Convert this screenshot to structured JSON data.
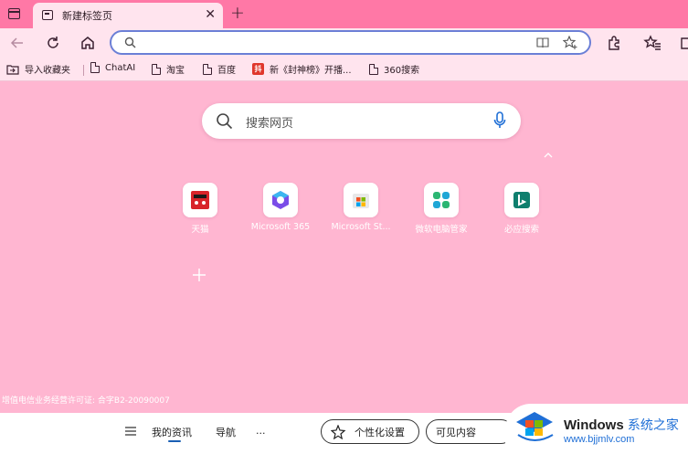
{
  "tab": {
    "title": "新建标签页"
  },
  "address_bar": {
    "value": "",
    "placeholder": ""
  },
  "bookmarks": [
    {
      "label": "导入收藏夹",
      "icon": "import-folder-icon"
    },
    {
      "label": "ChatAI",
      "icon": "page-icon"
    },
    {
      "label": "淘宝",
      "icon": "page-icon"
    },
    {
      "label": "百度",
      "icon": "page-icon"
    },
    {
      "label": "新《封神榜》开播...",
      "icon": "site-icon"
    },
    {
      "label": "360搜索",
      "icon": "page-icon"
    }
  ],
  "search": {
    "placeholder": "搜索网页"
  },
  "quick_links": [
    {
      "label": "天猫",
      "icon": "tmall-icon"
    },
    {
      "label": "Microsoft 365",
      "icon": "microsoft-365-icon"
    },
    {
      "label": "Microsoft St...",
      "icon": "microsoft-store-icon"
    },
    {
      "label": "微软电脑管家",
      "icon": "pc-manager-icon"
    },
    {
      "label": "必应搜索",
      "icon": "bing-icon"
    }
  ],
  "license": "增值电信业务经营许可证: 合字B2-20090007",
  "footer": {
    "my_news": "我的资讯",
    "navigation": "导航",
    "more": "...",
    "personalize": "个性化设置",
    "visible_content": "可见内容"
  },
  "watermark": {
    "title": "Windows",
    "title_zh": "系统之家",
    "url": "www.bjjmlv.com"
  },
  "colors": {
    "tab_bar": "#ff78a6",
    "toolbar": "#ffe4ee",
    "page_background": "#ffb6d1",
    "address_focus": "#6b7fd6"
  }
}
